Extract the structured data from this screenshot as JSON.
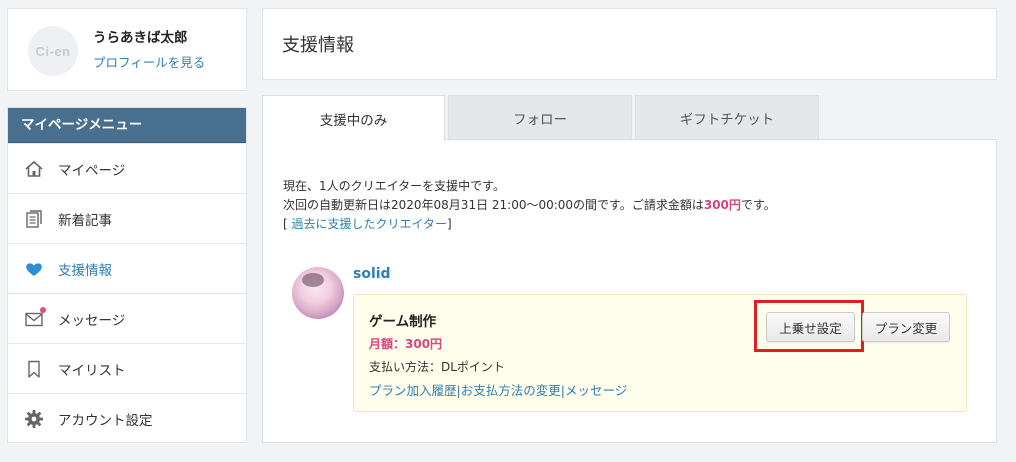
{
  "profile": {
    "logo_text": "Ci-en",
    "name": "うらあきば太郎",
    "view_profile_label": "プロフィールを見る"
  },
  "menu": {
    "header": "マイページメニュー",
    "items": [
      {
        "label": "マイページ",
        "icon": "home-icon"
      },
      {
        "label": "新着記事",
        "icon": "document-icon"
      },
      {
        "label": "支援情報",
        "icon": "heart-icon",
        "active": true
      },
      {
        "label": "メッセージ",
        "icon": "envelope-icon",
        "notification": true
      },
      {
        "label": "マイリスト",
        "icon": "bookmark-icon"
      },
      {
        "label": "アカウント設定",
        "icon": "gear-icon"
      }
    ]
  },
  "page": {
    "title": "支援情報"
  },
  "tabs": [
    {
      "label": "支援中のみ",
      "active": true
    },
    {
      "label": "フォロー",
      "active": false
    },
    {
      "label": "ギフトチケット",
      "active": false
    }
  ],
  "support_info": {
    "line1": "現在、1人のクリエイターを支援中です。",
    "line2_prefix": "次回の自動更新日は2020年08月31日 21:00～00:00の間です。ご請求金額は",
    "amount": "300円",
    "line2_suffix": "です。",
    "past_open": "[ ",
    "past_link": "過去に支援したクリエイター",
    "past_close": "]"
  },
  "creator": {
    "name": "solid",
    "plan": {
      "name": "ゲーム制作",
      "price": "月額：300円",
      "payment": "支払い方法：DLポイント",
      "links": [
        "プラン加入履歴",
        "お支払方法の変更",
        "メッセージ"
      ],
      "link_separator": "|",
      "topup_button": "上乗せ設定",
      "change_plan_button": "プラン変更"
    }
  },
  "colors": {
    "menu_header_bg": "#48708e",
    "link": "#2f7fb0",
    "accent_pink": "#d6457e",
    "highlight_red": "#e02020",
    "plan_box_bg": "#fffdeb"
  }
}
